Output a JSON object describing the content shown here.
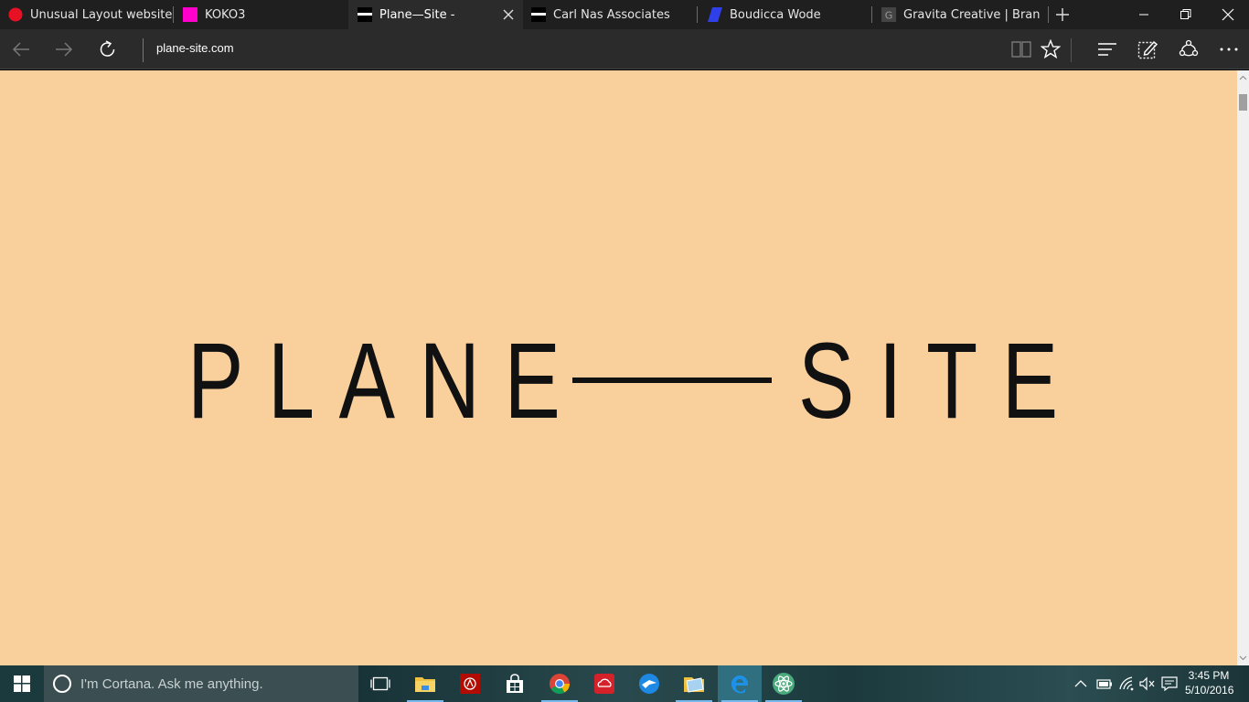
{
  "tabs": [
    {
      "title": "Unusual Layout websites,",
      "favicon": "red-circle-icon",
      "color": "#e81123",
      "active": false
    },
    {
      "title": "KOKO3",
      "favicon": "magenta-square-icon",
      "color": "#ff00cc",
      "active": false
    },
    {
      "title": "Plane—Site -",
      "favicon": "black-bar-icon",
      "color": "#000000",
      "active": true
    },
    {
      "title": "Carl Nas Associates",
      "favicon": "black-bar-icon",
      "color": "#000000",
      "active": false
    },
    {
      "title": "Boudicca Wode",
      "favicon": "blue-parallelogram-icon",
      "color": "#3040e8",
      "active": false
    },
    {
      "title": "Gravita Creative | Branding",
      "favicon": "g-letter-icon",
      "color": "#444444",
      "active": false
    }
  ],
  "navigation": {
    "address": "plane-site.com"
  },
  "page": {
    "background": "#f9cf9c",
    "logo": {
      "word1": "PLANE",
      "word2": "SITE",
      "full_text": "PLANE——SITE",
      "color": "#111111"
    }
  },
  "taskbar": {
    "cortana_placeholder": "I'm Cortana. Ask me anything.",
    "apps": [
      {
        "name": "task-view-icon"
      },
      {
        "name": "file-explorer-icon"
      },
      {
        "name": "acrobat-icon"
      },
      {
        "name": "store-icon"
      },
      {
        "name": "chrome-icon"
      },
      {
        "name": "creative-cloud-icon"
      },
      {
        "name": "messenger-icon"
      },
      {
        "name": "folder-photos-icon"
      },
      {
        "name": "edge-icon"
      },
      {
        "name": "atom-icon"
      }
    ],
    "clock": {
      "time": "3:45 PM",
      "date": "5/10/2016"
    }
  }
}
